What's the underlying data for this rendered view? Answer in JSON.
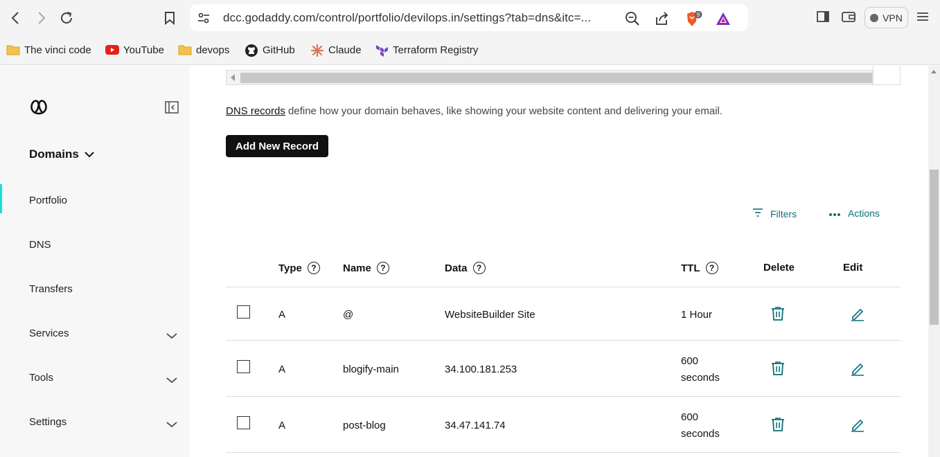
{
  "browser": {
    "url": "dcc.godaddy.com/control/portfolio/devilops.in/settings?tab=dns&itc=...",
    "brave_badge": "9",
    "vpn_label": "VPN"
  },
  "bookmarks": [
    {
      "label": "The vinci code",
      "icon": "folder-icon"
    },
    {
      "label": "YouTube",
      "icon": "youtube-icon"
    },
    {
      "label": "devops",
      "icon": "folder-icon"
    },
    {
      "label": "GitHub",
      "icon": "github-icon"
    },
    {
      "label": "Claude",
      "icon": "claude-icon"
    },
    {
      "label": "Terraform Registry",
      "icon": "terraform-icon"
    }
  ],
  "sidebar": {
    "section": "Domains",
    "items": [
      {
        "label": "Portfolio",
        "active": true
      },
      {
        "label": "DNS"
      },
      {
        "label": "Transfers"
      },
      {
        "label": "Services",
        "expandable": true
      },
      {
        "label": "Tools",
        "expandable": true
      },
      {
        "label": "Settings",
        "expandable": true
      }
    ]
  },
  "main": {
    "desc_link": "DNS records",
    "desc_rest": " define how your domain behaves, like showing your website content and delivering your email.",
    "add_button": "Add New Record",
    "filters_label": "Filters",
    "actions_label": "Actions",
    "columns": {
      "type": "Type",
      "name": "Name",
      "data": "Data",
      "ttl": "TTL",
      "delete": "Delete",
      "edit": "Edit"
    },
    "records": [
      {
        "type": "A",
        "name": "@",
        "data": "WebsiteBuilder Site",
        "ttl1": "1 Hour",
        "ttl2": ""
      },
      {
        "type": "A",
        "name": "blogify-main",
        "data": "34.100.181.253",
        "ttl1": "600",
        "ttl2": "seconds"
      },
      {
        "type": "A",
        "name": "post-blog",
        "data": "34.47.141.74",
        "ttl1": "600",
        "ttl2": "seconds"
      }
    ]
  },
  "colors": {
    "accent": "#0a6f78",
    "active_bar": "#1bdbdb",
    "button": "#111111"
  }
}
